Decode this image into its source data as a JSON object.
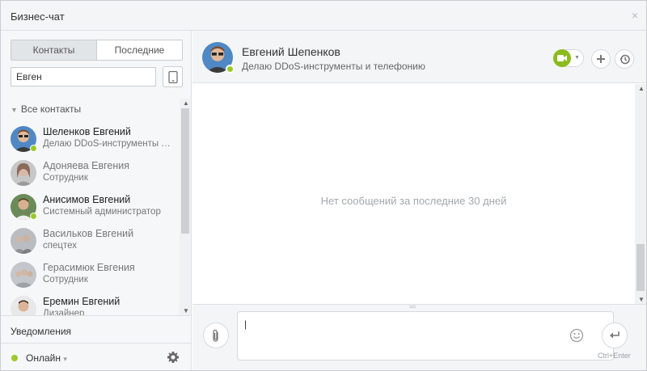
{
  "window": {
    "title": "Бизнес-чат",
    "close_glyph": "×"
  },
  "left": {
    "tabs": [
      {
        "label": "Контакты",
        "active": true
      },
      {
        "label": "Последние",
        "active": false
      }
    ],
    "search": {
      "value": "Евген"
    },
    "group_title": "Все контакты",
    "contacts": [
      {
        "name": "Шеленков Евгений",
        "status": "Делаю DDoS-инструменты и телефонию",
        "online": true,
        "avatar": "man-sunglasses"
      },
      {
        "name": "Адоняева Евгения",
        "status": "Сотрудник",
        "online": false,
        "avatar": "woman"
      },
      {
        "name": "Анисимов Евгений",
        "status": "Системный администратор",
        "online": true,
        "avatar": "man-outdoor"
      },
      {
        "name": "Васильков Евгений",
        "status": "спецтех",
        "online": false,
        "avatar": "man-group"
      },
      {
        "name": "Герасимюк Евгения",
        "status": "Сотрудник",
        "online": false,
        "avatar": "woman-group"
      },
      {
        "name": "Еремин Евгений",
        "status": "Дизайнер",
        "online": false,
        "avatar": "man"
      }
    ],
    "notifications_label": "Уведомления",
    "status_label": "Онлайн",
    "status_caret": "▾"
  },
  "chat": {
    "name": "Евгений Шепенков",
    "status": "Делаю DDoS-инструменты и телефонию",
    "empty_text": "Нет сообщений за последние 30 дней",
    "send_hint": "Ctrl+Enter"
  },
  "colors": {
    "online": "#9ac92a",
    "video_green": "#8cbb1d",
    "panel_bg": "#f4f5f6"
  }
}
